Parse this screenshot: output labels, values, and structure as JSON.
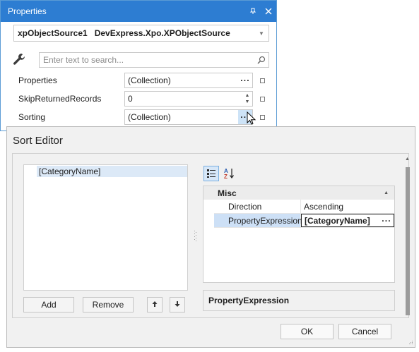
{
  "properties_window": {
    "title": "Properties",
    "title_icons": [
      "pin-icon",
      "close-icon"
    ],
    "object_selector": {
      "value": "xpObjectSource1   DevExpress.Xpo.XPObjectSource"
    },
    "search": {
      "placeholder": "Enter text to search..."
    },
    "rows": [
      {
        "name": "Properties",
        "value": "(Collection)"
      },
      {
        "name": "SkipReturnedRecords",
        "value": "0"
      },
      {
        "name": "Sorting",
        "value": "(Collection)"
      }
    ],
    "ellipsis": "···"
  },
  "sort_editor": {
    "title": "Sort Editor",
    "list_items": [
      "[CategoryName]"
    ],
    "add_label": "Add",
    "remove_label": "Remove",
    "property_grid": {
      "category": "Misc",
      "rows": [
        {
          "name": "Direction",
          "value": "Ascending"
        },
        {
          "name": "PropertyExpression",
          "value": "[CategoryName]"
        }
      ]
    },
    "description": "PropertyExpression",
    "ok_label": "OK",
    "cancel_label": "Cancel"
  },
  "colors": {
    "title_bar": "#2d7dd2",
    "selection": "#cde0f6",
    "dialog_bg": "#f1f1f1"
  }
}
